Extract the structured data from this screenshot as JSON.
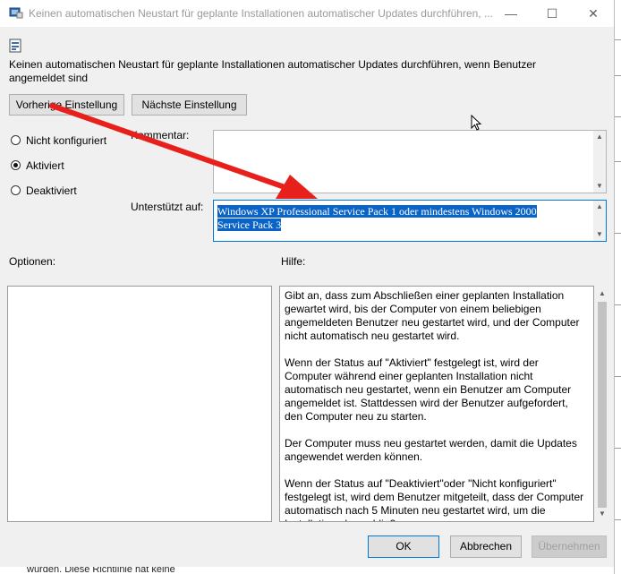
{
  "window": {
    "title": "Keinen automatischen Neustart für geplante Installationen automatischer Updates durchführen, ...",
    "minimize": "—",
    "maximize": "☐",
    "close": "✕"
  },
  "policy_heading": "Keinen automatischen Neustart für geplante Installationen automatischer Updates durchführen, wenn Benutzer angemeldet sind",
  "nav": {
    "previous": "Vorherige Einstellung",
    "next": "Nächste Einstellung"
  },
  "state": {
    "options": [
      {
        "label": "Nicht konfiguriert",
        "selected": false
      },
      {
        "label": "Aktiviert",
        "selected": true
      },
      {
        "label": "Deaktiviert",
        "selected": false
      }
    ]
  },
  "comment": {
    "label": "Kommentar:",
    "value": ""
  },
  "supported": {
    "label": "Unterstützt auf:",
    "value": "Windows XP Professional Service Pack 1 oder mindestens Windows 2000 Service Pack 3"
  },
  "options_label": "Optionen:",
  "help": {
    "label": "Hilfe:",
    "paragraphs": [
      "Gibt an, dass zum Abschließen einer geplanten Installation gewartet wird, bis der Computer von einem beliebigen angemeldeten Benutzer neu gestartet wird, und der Computer nicht automatisch neu gestartet wird.",
      "Wenn der Status auf \"Aktiviert\" festgelegt ist, wird der Computer während einer geplanten Installation nicht automatisch neu gestartet, wenn ein Benutzer am Computer angemeldet ist. Stattdessen wird der Benutzer aufgefordert, den Computer neu zu starten.",
      "Der Computer muss neu gestartet werden, damit die Updates angewendet werden können.",
      "Wenn der Status auf \"Deaktiviert\"oder \"Nicht konfiguriert\" festgelegt ist, wird dem Benutzer mitgeteilt, dass der Computer automatisch nach 5 Minuten neu gestartet wird, um die Installation abzuschließen."
    ]
  },
  "footer": {
    "ok": "OK",
    "cancel": "Abbrechen",
    "apply": "Übernehmen"
  },
  "background_text": "wurden. Diese Richtlinie hat keine",
  "annotation": {
    "arrow_color": "#e8201c"
  }
}
